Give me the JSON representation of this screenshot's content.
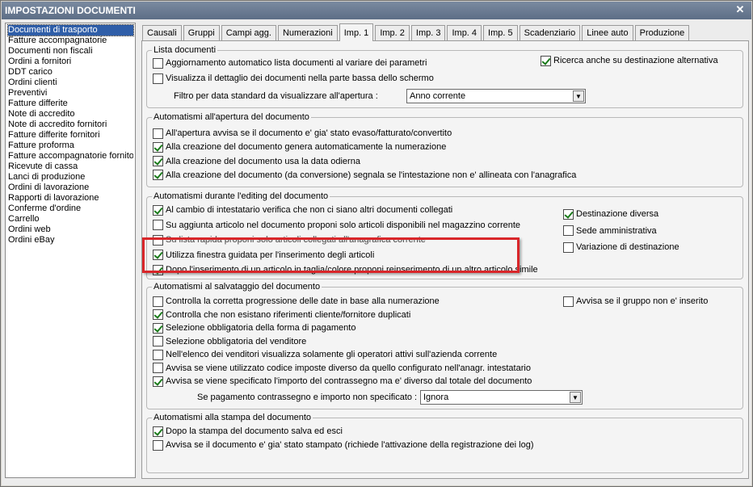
{
  "window": {
    "title": "IMPOSTAZIONI DOCUMENTI"
  },
  "sidebar": {
    "items": [
      "Documenti di trasporto",
      "Fatture accompagnatorie",
      "Documenti non fiscali",
      "Ordini a fornitori",
      "DDT carico",
      "Ordini clienti",
      "Preventivi",
      "Fatture differite",
      "Note di accredito",
      "Note di accredito fornitori",
      "Fatture differite fornitori",
      "Fatture proforma",
      "Fatture accompagnatorie fornito",
      "Ricevute di cassa",
      "Lanci di produzione",
      "Ordini di lavorazione",
      "Rapporti di lavorazione",
      "Conferme d'ordine",
      "Carrello",
      "Ordini web",
      "Ordini eBay"
    ],
    "selected_index": 0
  },
  "tabs": [
    "Causali",
    "Gruppi",
    "Campi agg.",
    "Numerazioni",
    "Imp. 1",
    "Imp. 2",
    "Imp. 3",
    "Imp. 4",
    "Imp. 5",
    "Scadenziario",
    "Linee auto",
    "Produzione"
  ],
  "active_tab_index": 4,
  "lista_documenti": {
    "title": "Lista documenti",
    "aggiornamento": {
      "label": "Aggiornamento automatico lista documenti al variare dei parametri",
      "checked": false
    },
    "visualizza_dettaglio": {
      "label": "Visualizza il dettaglio dei documenti nella parte bassa dello schermo",
      "checked": false
    },
    "ricerca_alternativa": {
      "label": "Ricerca anche su destinazione alternativa",
      "checked": true
    },
    "filtro_label": "Filtro per data standard da visualizzare all'apertura :",
    "filtro_value": "Anno corrente"
  },
  "apertura": {
    "title": "Automatismi all'apertura del documento",
    "items": [
      {
        "label": "All'apertura avvisa se il documento e' gia' stato evaso/fatturato/convertito",
        "checked": false
      },
      {
        "label": "Alla creazione del documento genera automaticamente la numerazione",
        "checked": true
      },
      {
        "label": "Alla creazione del documento usa la data odierna",
        "checked": true
      },
      {
        "label": "Alla creazione del documento (da conversione) segnala se l'intestazione non e' allineata con l'anagrafica",
        "checked": true
      }
    ]
  },
  "editing": {
    "title": "Automatismi durante l'editing del documento",
    "items": [
      {
        "label": "Al cambio di intestatario verifica che non ci siano altri documenti collegati",
        "checked": true
      },
      {
        "label": "Su aggiunta articolo nel documento proponi solo articoli disponibili nel magazzino corrente",
        "checked": false
      },
      {
        "label": "Su lista rapida proponi solo articoli collegati all'anagrafica corrente",
        "checked": false
      },
      {
        "label": "Utilizza finestra guidata per l'inserimento degli articoli",
        "checked": true
      },
      {
        "label": "Dopo l'inserimento di un articolo in taglia/colore proponi reinserimento di un altro articolo simile",
        "checked": true
      }
    ],
    "right": [
      {
        "label": "Destinazione diversa",
        "checked": true
      },
      {
        "label": "Sede amministrativa",
        "checked": false
      },
      {
        "label": "Variazione di destinazione",
        "checked": false
      }
    ]
  },
  "salvataggio": {
    "title": "Automatismi al salvataggio del documento",
    "items": [
      {
        "label": "Controlla la corretta progressione delle date in base alla numerazione",
        "checked": false
      },
      {
        "label": "Controlla che non esistano riferimenti cliente/fornitore duplicati",
        "checked": true
      },
      {
        "label": "Selezione obbligatoria della forma di pagamento",
        "checked": true
      },
      {
        "label": "Selezione obbligatoria del venditore",
        "checked": false
      },
      {
        "label": "Nell'elenco dei venditori visualizza solamente gli operatori attivi sull'azienda corrente",
        "checked": false
      },
      {
        "label": "Avvisa se viene utilizzato codice imposte diverso da quello configurato nell'anagr. intestatario",
        "checked": false
      },
      {
        "label": "Avvisa se viene specificato l'importo del contrassegno ma e' diverso dal totale del documento",
        "checked": true
      }
    ],
    "gruppo": {
      "label": "Avvisa se il gruppo non e' inserito",
      "checked": false
    },
    "contrassegno_label": "Se pagamento contrassegno e importo non specificato :",
    "contrassegno_value": "Ignora"
  },
  "stampa": {
    "title": "Automatismi alla stampa del documento",
    "items": [
      {
        "label": "Dopo la stampa del documento salva ed esci",
        "checked": true
      },
      {
        "label": "Avvisa se il documento e' gia' stato stampato (richiede l'attivazione della registrazione dei log)",
        "checked": false
      }
    ]
  }
}
